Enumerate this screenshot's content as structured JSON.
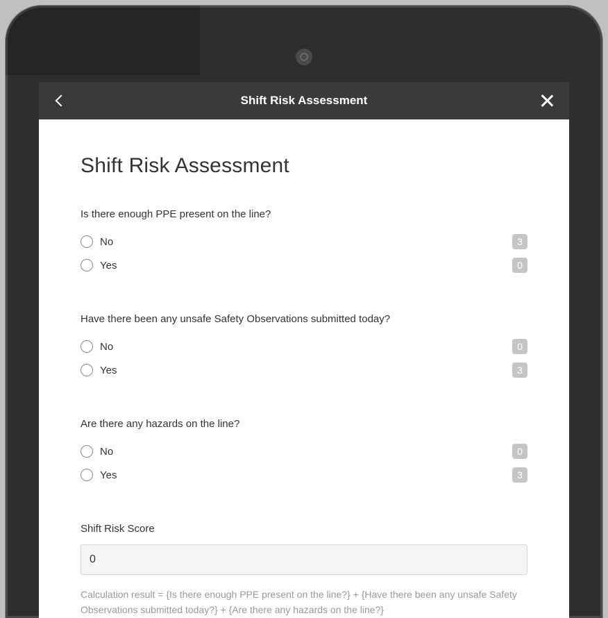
{
  "header": {
    "title": "Shift Risk Assessment"
  },
  "form": {
    "title": "Shift Risk Assessment",
    "questions": [
      {
        "text": "Is there enough PPE present on the line?",
        "options": [
          {
            "label": "No",
            "score": "3"
          },
          {
            "label": "Yes",
            "score": "0"
          }
        ]
      },
      {
        "text": "Have there been any unsafe Safety Observations submitted today?",
        "options": [
          {
            "label": "No",
            "score": "0"
          },
          {
            "label": "Yes",
            "score": "3"
          }
        ]
      },
      {
        "text": "Are there any hazards on the line?",
        "options": [
          {
            "label": "No",
            "score": "0"
          },
          {
            "label": "Yes",
            "score": "3"
          }
        ]
      }
    ],
    "score": {
      "label": "Shift Risk Score",
      "value": "0"
    },
    "calculation_text": "Calculation result = {Is there enough PPE present on the line?} + {Have there been any unsafe Safety Observations submitted today?} + {Are there any hazards on the line?}"
  }
}
